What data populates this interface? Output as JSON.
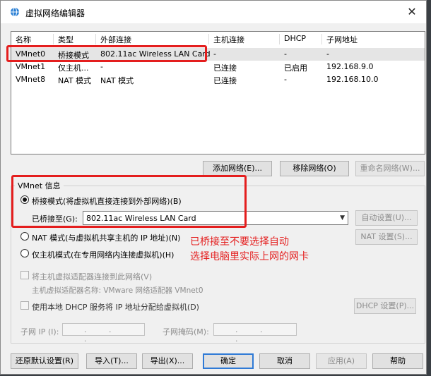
{
  "window": {
    "title": "虚拟网络编辑器",
    "close": "✕"
  },
  "network_list": {
    "headers": [
      "名称",
      "类型",
      "外部连接",
      "主机连接",
      "DHCP",
      "子网地址"
    ],
    "rows": [
      [
        "VMnet0",
        "桥接模式",
        "802.11ac Wireless LAN Card",
        "-",
        "-",
        "-"
      ],
      [
        "VMnet1",
        "仅主机...",
        "-",
        "已连接",
        "已启用",
        "192.168.9.0"
      ],
      [
        "VMnet8",
        "NAT 模式",
        "NAT 模式",
        "已连接",
        "-",
        "192.168.10.0"
      ]
    ],
    "selected_row": 0
  },
  "list_buttons": {
    "add": "添加网络(E)...",
    "remove": "移除网络(O)",
    "rename": "重命名网络(W)..."
  },
  "vmnet_info": {
    "title": "VMnet 信息",
    "bridged_label": "桥接模式(将虚拟机直接连接到外部网络)(B)",
    "bridged_to_label": "已桥接至(G):",
    "bridged_to_value": "802.11ac Wireless LAN Card",
    "auto_settings": "自动设置(U)...",
    "nat_label": "NAT 模式(与虚拟机共享主机的 IP 地址)(N)",
    "nat_settings": "NAT 设置(S)...",
    "host_only_label": "仅主机模式(在专用网络内连接虚拟机)(H)",
    "connect_adapter_label": "将主机虚拟适配器连接到此网络(V)",
    "adapter_name_label": "主机虚拟适配器名称: VMware 网络适配器 VMnet0",
    "dhcp_label": "使用本地 DHCP 服务将 IP 地址分配给虚拟机(D)",
    "dhcp_settings": "DHCP 设置(P)...",
    "subnet_ip_label": "子网 IP (I):",
    "subnet_mask_label": "子网掩码(M):",
    "ip_dots": ". . ."
  },
  "annotation": {
    "line1": "已桥接至不要选择自动",
    "line2": "选择电脑里实际上网的网卡"
  },
  "footer": {
    "restore": "还原默认设置(R)",
    "import": "导入(T)...",
    "export": "导出(X)...",
    "ok": "确定",
    "cancel": "取消",
    "apply": "应用(A)",
    "help": "帮助"
  },
  "colors": {
    "annotation_red": "#e41e1e",
    "primary_border": "#2f7ad6"
  }
}
